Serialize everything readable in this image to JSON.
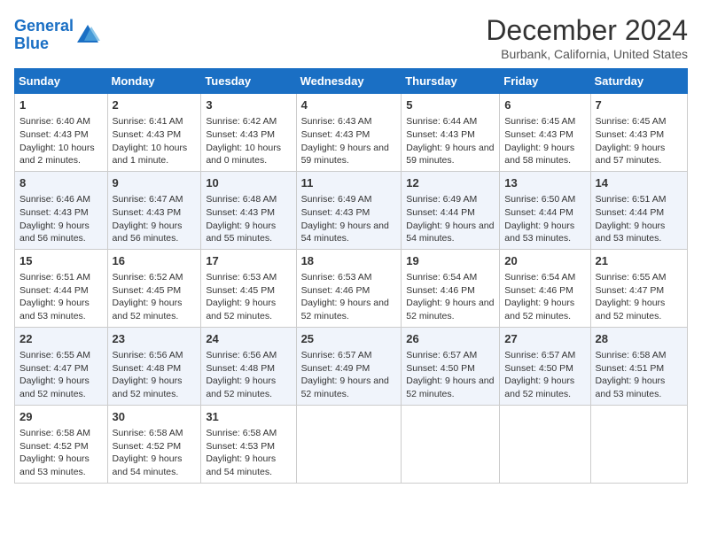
{
  "header": {
    "logo_line1": "General",
    "logo_line2": "Blue",
    "month": "December 2024",
    "location": "Burbank, California, United States"
  },
  "weekdays": [
    "Sunday",
    "Monday",
    "Tuesday",
    "Wednesday",
    "Thursday",
    "Friday",
    "Saturday"
  ],
  "weeks": [
    [
      {
        "day": "1",
        "sunrise": "6:40 AM",
        "sunset": "4:43 PM",
        "daylight": "10 hours and 2 minutes."
      },
      {
        "day": "2",
        "sunrise": "6:41 AM",
        "sunset": "4:43 PM",
        "daylight": "10 hours and 1 minute."
      },
      {
        "day": "3",
        "sunrise": "6:42 AM",
        "sunset": "4:43 PM",
        "daylight": "10 hours and 0 minutes."
      },
      {
        "day": "4",
        "sunrise": "6:43 AM",
        "sunset": "4:43 PM",
        "daylight": "9 hours and 59 minutes."
      },
      {
        "day": "5",
        "sunrise": "6:44 AM",
        "sunset": "4:43 PM",
        "daylight": "9 hours and 59 minutes."
      },
      {
        "day": "6",
        "sunrise": "6:45 AM",
        "sunset": "4:43 PM",
        "daylight": "9 hours and 58 minutes."
      },
      {
        "day": "7",
        "sunrise": "6:45 AM",
        "sunset": "4:43 PM",
        "daylight": "9 hours and 57 minutes."
      }
    ],
    [
      {
        "day": "8",
        "sunrise": "6:46 AM",
        "sunset": "4:43 PM",
        "daylight": "9 hours and 56 minutes."
      },
      {
        "day": "9",
        "sunrise": "6:47 AM",
        "sunset": "4:43 PM",
        "daylight": "9 hours and 56 minutes."
      },
      {
        "day": "10",
        "sunrise": "6:48 AM",
        "sunset": "4:43 PM",
        "daylight": "9 hours and 55 minutes."
      },
      {
        "day": "11",
        "sunrise": "6:49 AM",
        "sunset": "4:43 PM",
        "daylight": "9 hours and 54 minutes."
      },
      {
        "day": "12",
        "sunrise": "6:49 AM",
        "sunset": "4:44 PM",
        "daylight": "9 hours and 54 minutes."
      },
      {
        "day": "13",
        "sunrise": "6:50 AM",
        "sunset": "4:44 PM",
        "daylight": "9 hours and 53 minutes."
      },
      {
        "day": "14",
        "sunrise": "6:51 AM",
        "sunset": "4:44 PM",
        "daylight": "9 hours and 53 minutes."
      }
    ],
    [
      {
        "day": "15",
        "sunrise": "6:51 AM",
        "sunset": "4:44 PM",
        "daylight": "9 hours and 53 minutes."
      },
      {
        "day": "16",
        "sunrise": "6:52 AM",
        "sunset": "4:45 PM",
        "daylight": "9 hours and 52 minutes."
      },
      {
        "day": "17",
        "sunrise": "6:53 AM",
        "sunset": "4:45 PM",
        "daylight": "9 hours and 52 minutes."
      },
      {
        "day": "18",
        "sunrise": "6:53 AM",
        "sunset": "4:46 PM",
        "daylight": "9 hours and 52 minutes."
      },
      {
        "day": "19",
        "sunrise": "6:54 AM",
        "sunset": "4:46 PM",
        "daylight": "9 hours and 52 minutes."
      },
      {
        "day": "20",
        "sunrise": "6:54 AM",
        "sunset": "4:46 PM",
        "daylight": "9 hours and 52 minutes."
      },
      {
        "day": "21",
        "sunrise": "6:55 AM",
        "sunset": "4:47 PM",
        "daylight": "9 hours and 52 minutes."
      }
    ],
    [
      {
        "day": "22",
        "sunrise": "6:55 AM",
        "sunset": "4:47 PM",
        "daylight": "9 hours and 52 minutes."
      },
      {
        "day": "23",
        "sunrise": "6:56 AM",
        "sunset": "4:48 PM",
        "daylight": "9 hours and 52 minutes."
      },
      {
        "day": "24",
        "sunrise": "6:56 AM",
        "sunset": "4:48 PM",
        "daylight": "9 hours and 52 minutes."
      },
      {
        "day": "25",
        "sunrise": "6:57 AM",
        "sunset": "4:49 PM",
        "daylight": "9 hours and 52 minutes."
      },
      {
        "day": "26",
        "sunrise": "6:57 AM",
        "sunset": "4:50 PM",
        "daylight": "9 hours and 52 minutes."
      },
      {
        "day": "27",
        "sunrise": "6:57 AM",
        "sunset": "4:50 PM",
        "daylight": "9 hours and 52 minutes."
      },
      {
        "day": "28",
        "sunrise": "6:58 AM",
        "sunset": "4:51 PM",
        "daylight": "9 hours and 53 minutes."
      }
    ],
    [
      {
        "day": "29",
        "sunrise": "6:58 AM",
        "sunset": "4:52 PM",
        "daylight": "9 hours and 53 minutes."
      },
      {
        "day": "30",
        "sunrise": "6:58 AM",
        "sunset": "4:52 PM",
        "daylight": "9 hours and 54 minutes."
      },
      {
        "day": "31",
        "sunrise": "6:58 AM",
        "sunset": "4:53 PM",
        "daylight": "9 hours and 54 minutes."
      },
      null,
      null,
      null,
      null
    ]
  ],
  "labels": {
    "sunrise": "Sunrise:",
    "sunset": "Sunset:",
    "daylight": "Daylight:"
  }
}
